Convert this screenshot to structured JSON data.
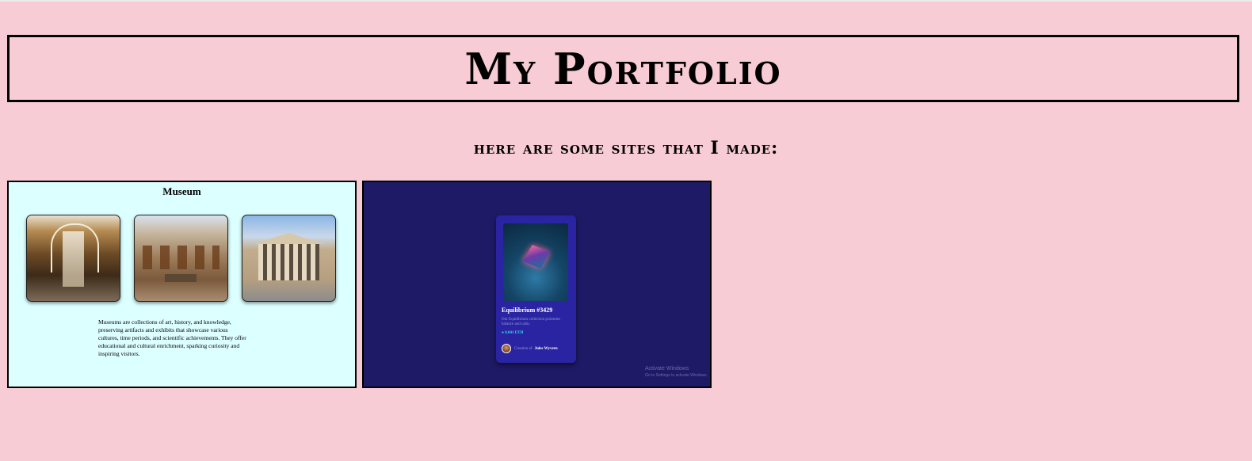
{
  "page": {
    "title": "My Portfolio",
    "subtitle": "here are some sites that I made:"
  },
  "projects": [
    {
      "id": "museum",
      "heading": "Museum",
      "photos": [
        "museum-hall-photo",
        "art-gallery-photo",
        "museum-building-photo"
      ],
      "description": "Museums are collections of art, history, and knowledge, preserving artifacts and exhibits that showcase various cultures, time periods, and scientific achievements. They offer educational and cultural enrichment, sparking curiosity and inspiring visitors."
    },
    {
      "id": "nft",
      "name": "Equilibrium #3429",
      "description": "Our Equilibrium collection promotes balance and calm.",
      "price": "0.041 ETH",
      "creator_prefix": "Creation of",
      "creator_name": "Jules Wyvern",
      "watermark_title": "Activate Windows",
      "watermark_sub": "Go to Settings to activate Windows."
    }
  ],
  "colors": {
    "page_background": "#f8ccd5",
    "museum_background": "#dcffff",
    "nft_background": "#1e1a66",
    "nft_card": "#2a24a3",
    "nft_price": "#38d6f0"
  }
}
